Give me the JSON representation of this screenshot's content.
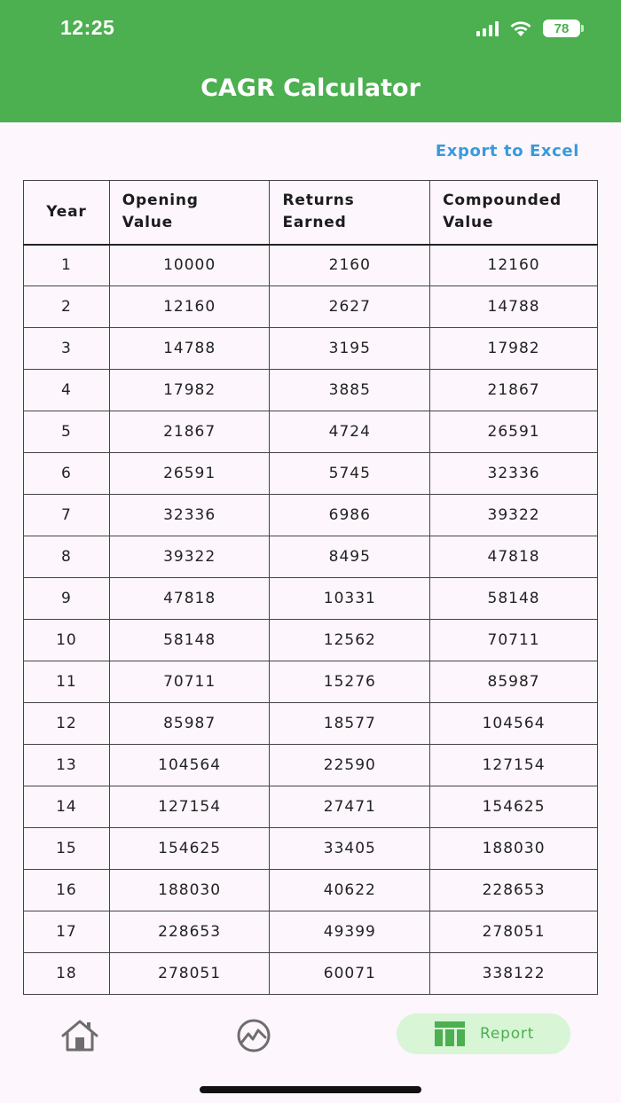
{
  "status_bar": {
    "time": "12:25",
    "battery": "78",
    "icons": [
      "cellular-signal-icon",
      "wifi-icon",
      "battery-icon"
    ]
  },
  "header": {
    "title": "CAGR Calculator",
    "color": "#4caf50"
  },
  "export_label": "Export to Excel",
  "table": {
    "headers": {
      "year": "Year",
      "opening_line1": "Opening",
      "opening_line2": "Value",
      "returns_line1": "Returns",
      "returns_line2": "Earned",
      "compounded_line1": "Compounded",
      "compounded_line2": "Value"
    },
    "rows": [
      [
        "1",
        "10000",
        "2160",
        "12160"
      ],
      [
        "2",
        "12160",
        "2627",
        "14788"
      ],
      [
        "3",
        "14788",
        "3195",
        "17982"
      ],
      [
        "4",
        "17982",
        "3885",
        "21867"
      ],
      [
        "5",
        "21867",
        "4724",
        "26591"
      ],
      [
        "6",
        "26591",
        "5745",
        "32336"
      ],
      [
        "7",
        "32336",
        "6986",
        "39322"
      ],
      [
        "8",
        "39322",
        "8495",
        "47818"
      ],
      [
        "9",
        "47818",
        "10331",
        "58148"
      ],
      [
        "10",
        "58148",
        "12562",
        "70711"
      ],
      [
        "11",
        "70711",
        "15276",
        "85987"
      ],
      [
        "12",
        "85987",
        "18577",
        "104564"
      ],
      [
        "13",
        "104564",
        "22590",
        "127154"
      ],
      [
        "14",
        "127154",
        "27471",
        "154625"
      ],
      [
        "15",
        "154625",
        "33405",
        "188030"
      ],
      [
        "16",
        "188030",
        "40622",
        "228653"
      ],
      [
        "17",
        "228653",
        "49399",
        "278051"
      ],
      [
        "18",
        "278051",
        "60071",
        "338122"
      ]
    ]
  },
  "bottom_nav": {
    "items": [
      {
        "icon": "home-icon"
      },
      {
        "icon": "chart-icon"
      },
      {
        "icon": "table-icon",
        "label": "Report",
        "active": true
      }
    ],
    "active_color": "#4caf50"
  }
}
